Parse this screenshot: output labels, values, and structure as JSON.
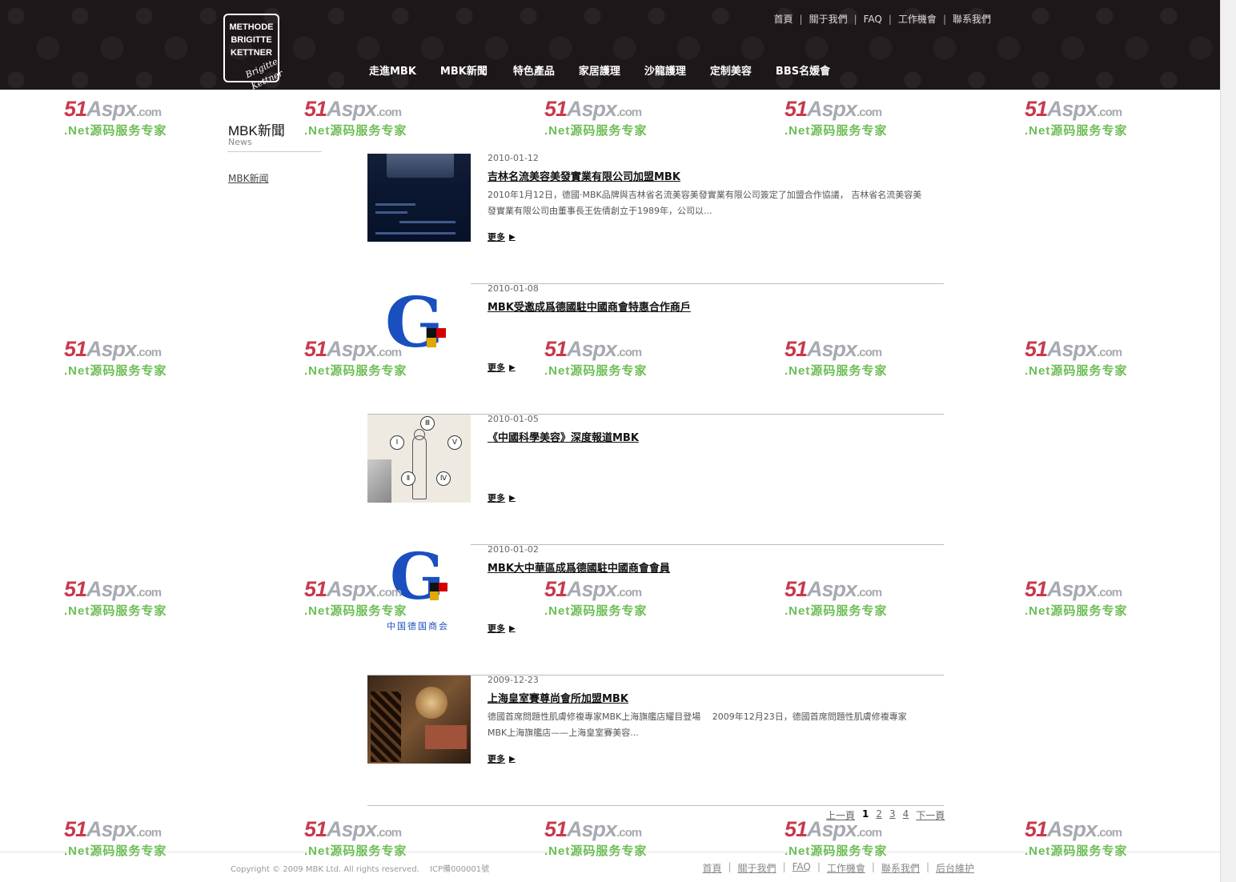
{
  "logo": {
    "lines": [
      "METHODE",
      "BRIGITTE",
      "KETTNER"
    ],
    "signature": "Brigitte Kettner"
  },
  "top_links": [
    "首頁",
    "關于我們",
    "FAQ",
    "工作機會",
    "聯系我們"
  ],
  "main_nav": [
    "走進MBK",
    "MBK新聞",
    "特色產品",
    "家居護理",
    "沙龍護理",
    "定制美容",
    "BBS名媛會"
  ],
  "sidebar": {
    "title": "MBK新聞",
    "subtitle": "News",
    "link": "MBK新闻"
  },
  "more_label": "更多",
  "news": [
    {
      "date": "2010-01-12",
      "title": "吉林名流美容美發實業有限公司加盟MBK",
      "summary": "2010年1月12日，德國·MBK品牌與吉林省名流美容美發實業有限公司簽定了加盟合作協議， 吉林省名流美容美發實業有限公司由董事長王佐倩創立于1989年，公司以...",
      "thumb": "screen"
    },
    {
      "date": "2010-01-08",
      "title": "MBK受邀成爲德國駐中國商會特惠合作商戶",
      "summary": "",
      "thumb": "chamber-logo"
    },
    {
      "date": "2010-01-05",
      "title": "《中國科學美容》深度報道MBK",
      "summary": "",
      "thumb": "body-diagram"
    },
    {
      "date": "2010-01-02",
      "title": "MBK大中華區成爲德國駐中國商會會員",
      "summary": "",
      "thumb": "chamber-logo-text",
      "thumb_caption": "中国德国商会"
    },
    {
      "date": "2009-12-23",
      "title": "上海皇室賽尊尚會所加盟MBK",
      "summary": "德國首席問題性肌膚修複專家MBK上海旗艦店耀目登場　 2009年12月23日，德國首席問題性肌膚修複專家MBK上海旗艦店——上海皇室賽美容...",
      "thumb": "interior"
    }
  ],
  "thumb_roman": [
    "Ⅲ",
    "Ⅰ",
    "Ⅴ",
    "Ⅱ",
    "Ⅳ"
  ],
  "pager": {
    "prev": "上一頁",
    "pages": [
      "1",
      "2",
      "3",
      "4"
    ],
    "current": "1",
    "next": "下一頁"
  },
  "footer": {
    "copyright": "Copyright © 2009 MBK Ltd. All rights reserved.　 ICP備000001號",
    "links": [
      "首頁",
      "關于我們",
      "FAQ",
      "工作機會",
      "聯系我們",
      "后台維护"
    ]
  },
  "watermark": {
    "brand": "51",
    "brand2": "Aspx",
    "domain": ".com",
    "tagline": ".Net源码服务专家"
  },
  "colors": {
    "header_bg": "#1e1719",
    "watermark_red": "#c9394b",
    "watermark_green": "#6dbd55"
  }
}
